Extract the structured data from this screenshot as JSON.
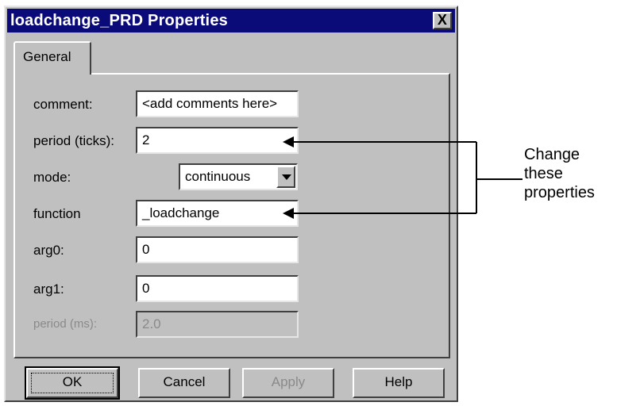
{
  "window": {
    "title": "loadchange_PRD Properties",
    "close_icon": "close-icon",
    "close_label": "X"
  },
  "tabs": [
    {
      "label": "General"
    }
  ],
  "fields": {
    "comment": {
      "label": "comment:",
      "value": "<add comments here>"
    },
    "period_ticks": {
      "label": "period (ticks):",
      "value": "2"
    },
    "mode": {
      "label": "mode:",
      "value": "continuous",
      "icon": "chevron-down-icon"
    },
    "function": {
      "label": "function",
      "value": "_loadchange"
    },
    "arg0": {
      "label": "arg0:",
      "value": "0"
    },
    "arg1": {
      "label": "arg1:",
      "value": "0"
    },
    "period_ms": {
      "label": "period (ms):",
      "value": "2.0",
      "disabled": true
    }
  },
  "buttons": {
    "ok": "OK",
    "cancel": "Cancel",
    "apply": "Apply",
    "help": "Help"
  },
  "annotation": {
    "line1": "Change",
    "line2": "these",
    "line3": "properties"
  }
}
